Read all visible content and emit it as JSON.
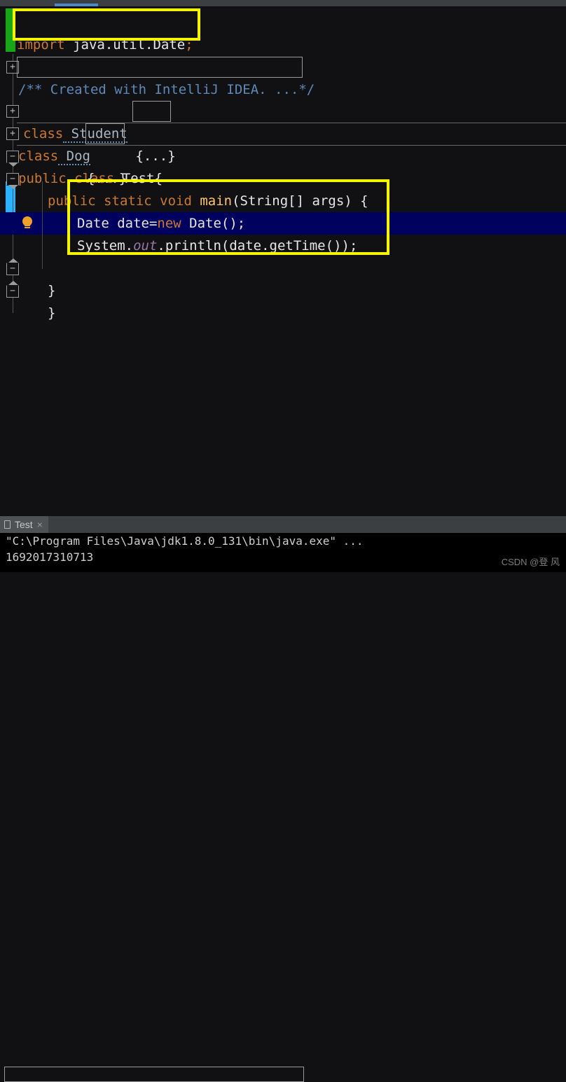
{
  "window": {
    "theme": "darcula",
    "editor_background": "#111113",
    "console_background": "#000000",
    "tabbar_background": "#3c3f41",
    "accent_blue": "#4a88c7",
    "highlight_yellow": "#f5f500",
    "current_line_background": "#00005f"
  },
  "editor": {
    "language": "java",
    "lines": [
      {
        "n": 1,
        "indent": 0,
        "text": "import java.util.Date;",
        "tokens": [
          {
            "t": "import",
            "c": "keyword"
          },
          {
            "t": " java.util.Date",
            "c": "plain"
          },
          {
            "t": ";",
            "c": "keyword"
          }
        ],
        "fold": "none",
        "change": "green"
      },
      {
        "n": 2,
        "indent": 0,
        "text": "",
        "tokens": [],
        "fold": "none",
        "change": "none"
      },
      {
        "n": 3,
        "indent": 0,
        "text": "/** Created with IntelliJ IDEA. ...*/",
        "tokens": [
          {
            "t": "/** Created with IntelliJ IDEA. ...*/",
            "c": "doc-folded"
          }
        ],
        "fold": "collapsed",
        "change": "none"
      },
      {
        "n": 4,
        "indent": 0,
        "text": "",
        "tokens": [],
        "fold": "none",
        "change": "none"
      },
      {
        "n": 5,
        "indent": 1,
        "text": "class Student {...}",
        "tokens": [
          {
            "t": "class",
            "c": "keyword"
          },
          {
            "t": " Student",
            "c": "class-name-warned"
          },
          {
            "t": " {...}",
            "c": "folded"
          }
        ],
        "fold": "collapsed",
        "change": "none"
      },
      {
        "n": 6,
        "indent": 0,
        "text": "class Dog{...}",
        "tokens": [
          {
            "t": "class",
            "c": "keyword"
          },
          {
            "t": " Dog",
            "c": "class-name-warned"
          },
          {
            "t": "{...}",
            "c": "folded"
          }
        ],
        "fold": "collapsed",
        "change": "none"
      },
      {
        "n": 7,
        "indent": 0,
        "text": "public class Test{",
        "tokens": [
          {
            "t": "public class",
            "c": "keyword"
          },
          {
            "t": " Test{",
            "c": "plain"
          }
        ],
        "fold": "expanded-down",
        "change": "none"
      },
      {
        "n": 8,
        "indent": 2,
        "text": "public static void main(String[] args) {",
        "tokens": [
          {
            "t": "public static void",
            "c": "keyword"
          },
          {
            "t": " main",
            "c": "method"
          },
          {
            "t": "(String[] args) {",
            "c": "plain"
          }
        ],
        "fold": "expanded-down",
        "change": "none"
      },
      {
        "n": 9,
        "indent": 3,
        "text": "Date date=new Date();",
        "tokens": [
          {
            "t": "Date date=",
            "c": "plain"
          },
          {
            "t": "new",
            "c": "keyword"
          },
          {
            "t": " Date();",
            "c": "plain"
          }
        ],
        "fold": "none",
        "change": "blue"
      },
      {
        "n": 10,
        "indent": 3,
        "text": "System.out.println(date.getTime());",
        "tokens": [
          {
            "t": "System.",
            "c": "plain"
          },
          {
            "t": "out",
            "c": "static-field"
          },
          {
            "t": ".println(date.getTime());",
            "c": "plain"
          }
        ],
        "fold": "none",
        "change": "blue",
        "current": true,
        "gutter_icon": "lightbulb-icon"
      },
      {
        "n": 11,
        "indent": 2,
        "text": "}",
        "tokens": [
          {
            "t": "}",
            "c": "plain"
          }
        ],
        "fold": "expanded-up",
        "change": "none"
      },
      {
        "n": 12,
        "indent": 1,
        "text": "}",
        "tokens": [
          {
            "t": "}",
            "c": "plain"
          }
        ],
        "fold": "expanded-up",
        "change": "none"
      }
    ],
    "annotations": [
      {
        "name": "import-highlight-box",
        "color": "#f5f500"
      },
      {
        "name": "statements-highlight-box",
        "color": "#f5f500"
      }
    ]
  },
  "console": {
    "tab": {
      "label": "Test",
      "close_label": "×",
      "icon": "run-tab-icon"
    },
    "output": [
      "\"C:\\Program Files\\Java\\jdk1.8.0_131\\bin\\java.exe\" ...",
      "1692017310713"
    ],
    "boxed_line_index": 0
  },
  "watermark": {
    "text": "CSDN @登 风"
  }
}
